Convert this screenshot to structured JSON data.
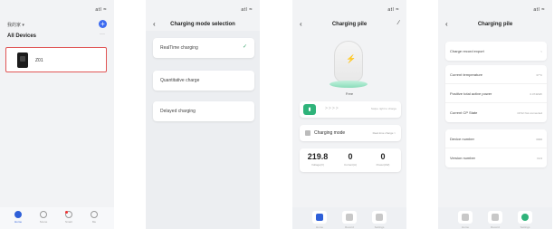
{
  "status": {
    "signal": "atl",
    "wifi": "≈"
  },
  "screen1": {
    "home_title": "我的家 ▾",
    "add_label": "+",
    "section_title": "All Devices",
    "more_label": "···",
    "device_name": "Z01",
    "tabs": [
      {
        "label": "Home",
        "icon": "home-icon"
      },
      {
        "label": "Scene",
        "icon": "scene-icon"
      },
      {
        "label": "Smart",
        "icon": "smart-icon"
      },
      {
        "label": "Me",
        "icon": "me-icon"
      }
    ]
  },
  "screen2": {
    "title": "Charging mode selection",
    "back_label": "‹",
    "modes": [
      {
        "label": "RealTime charging",
        "selected": true
      },
      {
        "label": "Quantitative charge",
        "selected": false
      },
      {
        "label": "Delayed charging",
        "selected": false
      }
    ],
    "check_label": "✓"
  },
  "screen3": {
    "title": "Charging pile",
    "back_label": "‹",
    "edit_label": "∕",
    "pile_status": "Free",
    "swipe_arrows": ">>>>",
    "swipe_hint": "Swipe right to charge",
    "mode_label": "Charging mode",
    "mode_value": "Real-time charge >",
    "stats": [
      {
        "value": "219.8",
        "unit": "Voltage(V)"
      },
      {
        "value": "0",
        "unit": "Current(A)"
      },
      {
        "value": "0",
        "unit": "Power(kW)"
      }
    ],
    "tabs": [
      {
        "label": "Home",
        "icon": "home-icon"
      },
      {
        "label": "Record",
        "icon": "record-icon"
      },
      {
        "label": "Settings",
        "icon": "settings-icon"
      }
    ]
  },
  "screen4": {
    "title": "Charging pile",
    "back_label": "‹",
    "group1": [
      {
        "key": "Charge record export",
        "value": ">"
      }
    ],
    "group2": [
      {
        "key": "Current temperature",
        "value": "37°C"
      },
      {
        "key": "Positive total active power",
        "value": "0.074kWh"
      },
      {
        "key": "Current CP State",
        "value": "CP12 Not connected"
      }
    ],
    "group3": [
      {
        "key": "Device number",
        "value": "0000"
      },
      {
        "key": "Version number",
        "value": "V2.0"
      }
    ],
    "tabs": [
      {
        "label": "Home",
        "icon": "home-icon"
      },
      {
        "label": "Record",
        "icon": "record-icon"
      },
      {
        "label": "Settings",
        "icon": "settings-icon"
      }
    ]
  }
}
